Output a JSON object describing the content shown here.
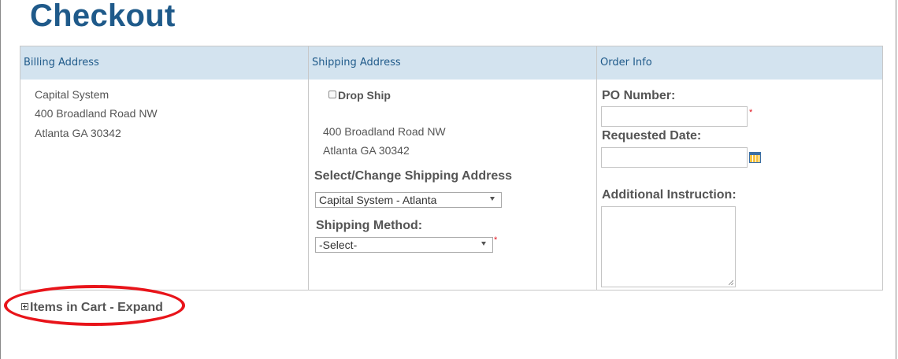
{
  "page": {
    "title": "Checkout"
  },
  "columns": {
    "billing": "Billing Address",
    "shipping": "Shipping Address",
    "order": "Order Info"
  },
  "billing": {
    "line1": "Capital System",
    "line2": "400 Broadland Road NW",
    "line3": "Atlanta GA 30342"
  },
  "shipping": {
    "drop_ship_label": "Drop Ship",
    "drop_ship_checked": false,
    "line1": "400 Broadland Road NW",
    "line2": "Atlanta GA 30342",
    "select_address_label": "Select/Change Shipping Address",
    "selected_address": "Capital System - Atlanta",
    "method_label": "Shipping Method:",
    "selected_method": "-Select-",
    "method_required": "*"
  },
  "order": {
    "po_label": "PO Number:",
    "po_value": "",
    "po_required": "*",
    "date_label": "Requested Date:",
    "date_value": "",
    "instruction_label": "Additional Instruction:",
    "instruction_value": ""
  },
  "cart": {
    "expand_label": "Items in Cart - Expand"
  },
  "colors": {
    "title": "#1f5a8a",
    "header_bg": "#d3e3ef",
    "required": "#e0141e",
    "annotation": "#e8141a"
  },
  "icons": {
    "calendar": "calendar-icon",
    "expand": "plus-box-icon"
  }
}
